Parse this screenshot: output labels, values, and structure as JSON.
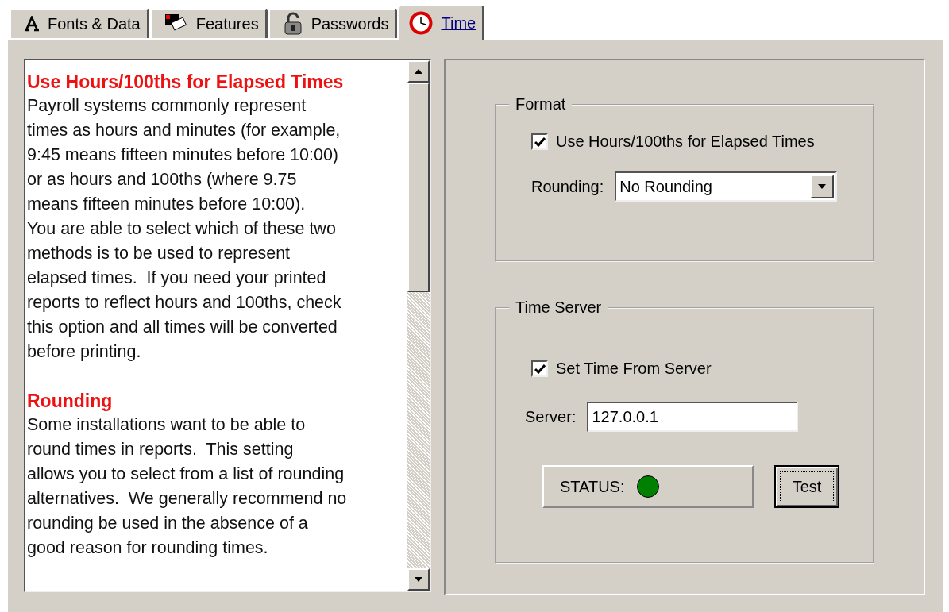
{
  "tabs": [
    {
      "label": "Fonts & Data",
      "kind": "font",
      "selected": false
    },
    {
      "label": "Features",
      "kind": "features",
      "selected": false
    },
    {
      "label": "Passwords",
      "kind": "lock",
      "selected": false
    },
    {
      "label": "Time",
      "kind": "clock",
      "selected": true
    }
  ],
  "help": {
    "blocks": [
      {
        "kind": "heading",
        "text": "Use Hours/100ths for Elapsed Times"
      },
      {
        "kind": "paragraph",
        "text": "Payroll systems commonly represent\ntimes as hours and minutes (for example,\n9:45 means fifteen minutes before 10:00)\nor as hours and 100ths (where 9.75\nmeans fifteen minutes before 10:00).\nYou are able to select which of these two\nmethods is to be used to represent\nelapsed times.  If you need your printed\nreports to reflect hours and 100ths, check\nthis option and all times will be converted\nbefore printing."
      },
      {
        "kind": "heading",
        "text": "Rounding"
      },
      {
        "kind": "paragraph",
        "text": "Some installations want to be able to\nround times in reports.  This setting\nallows you to select from a list of rounding\nalternatives.  We generally recommend no\nrounding be used in the absence of a\ngood reason for rounding times."
      }
    ]
  },
  "format": {
    "title": "Format",
    "checkbox": {
      "label": "Use Hours/100ths for Elapsed Times",
      "checked": true
    },
    "rounding_label": "Rounding:",
    "rounding_value": "No Rounding"
  },
  "time_server": {
    "title": "Time Server",
    "checkbox": {
      "label": "Set Time From Server",
      "checked": true
    },
    "server_label": "Server:",
    "server_value": "127.0.0.1",
    "status": {
      "label": "STATUS:",
      "color": "#008000"
    },
    "test_button": "Test"
  }
}
